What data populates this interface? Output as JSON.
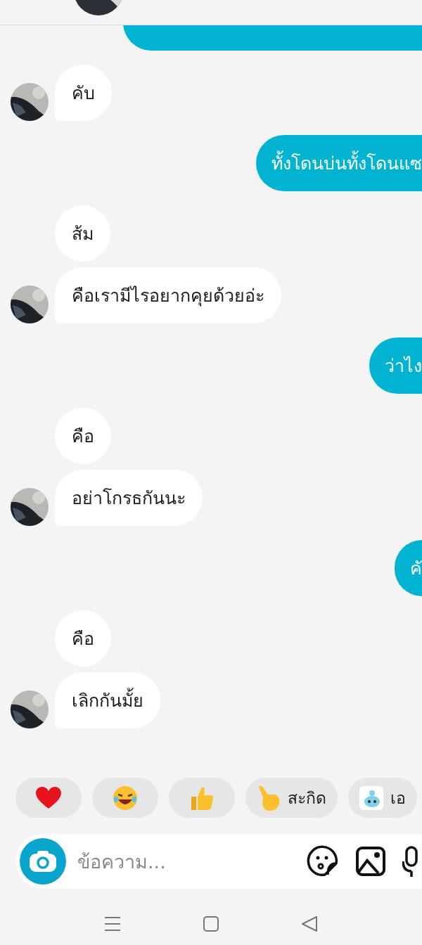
{
  "messages": [
    {
      "kind": "sent"
    },
    {
      "kind": "received",
      "text": "คับ",
      "avatar": true
    },
    {
      "kind": "sent",
      "text": "ทั้งโดนบ่นทั้งโดนแซ"
    },
    {
      "kind": "received",
      "text": "ส้ม",
      "avatar": false
    },
    {
      "kind": "received",
      "text": "คือเรามีไรอยากคุยด้วยอ่ะ",
      "avatar": true
    },
    {
      "kind": "sent",
      "text": "ว่าไง"
    },
    {
      "kind": "received",
      "text": "คือ",
      "avatar": false
    },
    {
      "kind": "received",
      "text": "อย่าโกรธกันนะ",
      "avatar": true
    },
    {
      "kind": "sent",
      "text": "คั"
    },
    {
      "kind": "received",
      "text": "คือ",
      "avatar": false
    },
    {
      "kind": "received",
      "text": "เลิกกันมั้ย",
      "avatar": true
    }
  ],
  "quick_replies": [
    {
      "kind": "heart"
    },
    {
      "kind": "laugh"
    },
    {
      "kind": "thumbs"
    },
    {
      "kind": "poke",
      "label": "สะกิด"
    },
    {
      "kind": "sticker",
      "label": "เอ"
    }
  ],
  "composer": {
    "placeholder": "ข้อความ..."
  }
}
